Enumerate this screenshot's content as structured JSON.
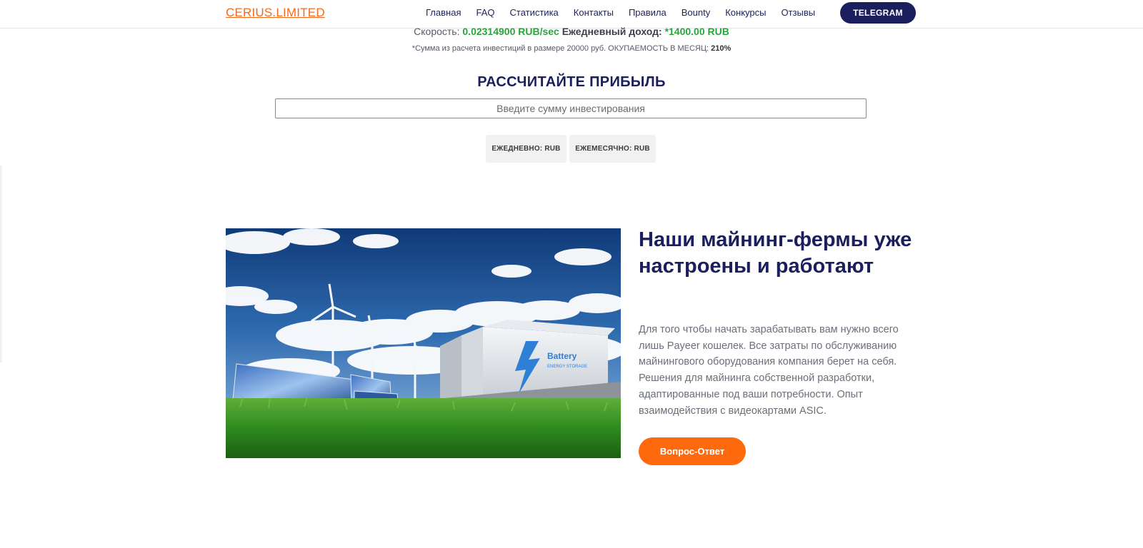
{
  "header": {
    "logo": "CERIUS.LIMITED",
    "nav": [
      "Главная",
      "FAQ",
      "Статистика",
      "Контакты",
      "Правила",
      "Bounty",
      "Конкурсы",
      "Отзывы"
    ],
    "telegram_label": "TELEGRAM"
  },
  "stats": {
    "speed_label": "Скорость:",
    "speed_value": "0.02314900 RUB/sec",
    "income_label": "Ежедневный доход:",
    "income_value": "*1400.00 RUB",
    "note_text": "*Сумма из расчета инвестиций в размере 20000 руб. ОКУПАЕМОСТЬ В МЕСЯЦ:",
    "note_value": "210%"
  },
  "calculator": {
    "title": "РАССЧИТАЙТЕ ПРИБЫЛЬ",
    "input_placeholder": "Введите сумму инвестирования",
    "input_value": "",
    "daily_label": "ЕЖЕДНЕВНО: RUB",
    "monthly_label": "ЕЖЕМЕСЯЧНО: RUB"
  },
  "feature": {
    "title": "Наши майнинг-фермы уже настроены и работают",
    "text": "Для того чтобы начать зарабатывать вам нужно всего лишь Payeer кошелек. Все затраты по обслуживанию майнингового оборудования компания берет на себя. Решения для майнинга собственной разработки, адаптированные под ваши потребности. Опыт взаимодействия с видеокартами ASIC.",
    "button_label": "Вопрос-Ответ",
    "image": {
      "battery_text": "Battery",
      "battery_subtext": "ENERGY STORAGE"
    }
  },
  "colors": {
    "brand_orange": "#f26b1d",
    "navy": "#1c1f5e",
    "green": "#2ba33d",
    "button_orange": "#ff6a0f"
  }
}
